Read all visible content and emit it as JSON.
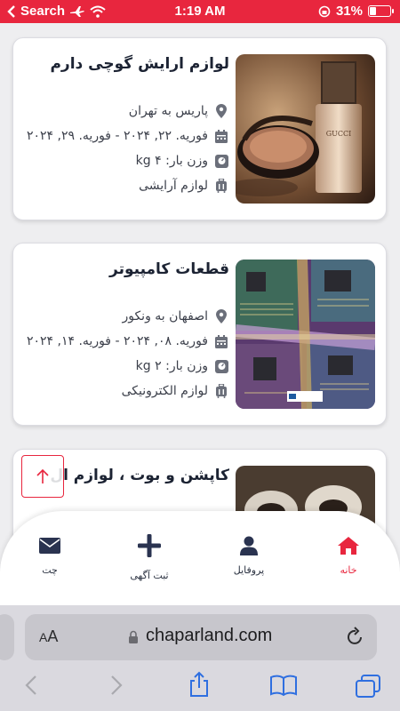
{
  "status_bar": {
    "back_app": "Search",
    "time": "1:19 AM",
    "battery": "31%",
    "battery_level": 0.31
  },
  "cards": [
    {
      "title": "لوازم ارایش گوچی دارم",
      "route": "پاریس به تهران",
      "dates": "فوریه. ۲۲, ۲۰۲۴ - فوریه. ۲۹, ۲۰۲۴",
      "weight": "وزن بار: ۴ kg",
      "category": "لوازم آرایشی",
      "image": "cosmetics-photo"
    },
    {
      "title": "قطعات کامپیوتر",
      "route": "اصفهان به ونکور",
      "dates": "فوریه. ۰۸, ۲۰۲۴ - فوریه. ۱۴, ۲۰۲۴",
      "weight": "وزن بار: ۲ kg",
      "category": "لوازم الکترونیکی",
      "image": "circuit-board-photo"
    },
    {
      "title": "کاپشن و بوت ، لوازم ال",
      "image": "boots-photo"
    }
  ],
  "bottom_nav": {
    "home": "خانه",
    "profile": "پروفایل",
    "post_ad": "ثبت آگهی",
    "chat": "چت"
  },
  "browser": {
    "aa": "AA",
    "url": "chaparland.com"
  },
  "colors": {
    "accent": "#e8263e",
    "navy": "#2a3350"
  }
}
